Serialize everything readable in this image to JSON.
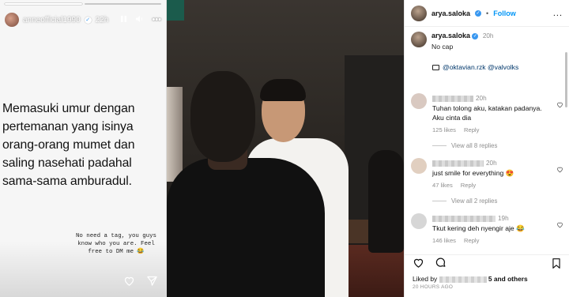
{
  "story": {
    "username": "anneofficial1990",
    "time": "22h",
    "main_text": "Memasuki umur dengan pertemanan yang isinya orang-orang mumet dan saling nasehati padahal sama-sama amburadul.",
    "note_text": "No need a tag, you guys know who you are. Feel free to DM me 😂",
    "pause_icon": "pause-icon",
    "mute_icon": "speaker-icon",
    "more_icon": "ellipsis-icon",
    "like_icon": "heart-icon",
    "share_icon": "send-icon"
  },
  "post": {
    "header": {
      "username": "arya.saloka",
      "separator": "•",
      "follow_label": "Follow",
      "more_label": "..."
    },
    "caption": {
      "username": "arya.saloka",
      "time": "20h",
      "text": "No cap",
      "tags": "@oktavian.rzk @valvolks"
    },
    "comments": [
      {
        "time": "20h",
        "text": "Tuhan tolong aku, katakan padanya. Aku cinta dia",
        "likes": "125 likes",
        "reply": "Reply",
        "view_replies": "View all 8 replies"
      },
      {
        "time": "20h",
        "text": "just smile for everything 😍",
        "likes": "47 likes",
        "reply": "Reply",
        "view_replies": "View all 2 replies"
      },
      {
        "time": "19h",
        "text": "Tkut kering deh nyengir aje 😂",
        "likes": "146 likes",
        "reply": "Reply"
      }
    ],
    "footer": {
      "liked_by_prefix": "Liked by",
      "liked_by_suffix": "5 and",
      "others": "others",
      "time_ago": "20 HOURS AGO"
    },
    "colors": {
      "link_blue": "#0095f6",
      "verified_blue": "#3897f0",
      "muted": "#8e8e8e"
    }
  }
}
